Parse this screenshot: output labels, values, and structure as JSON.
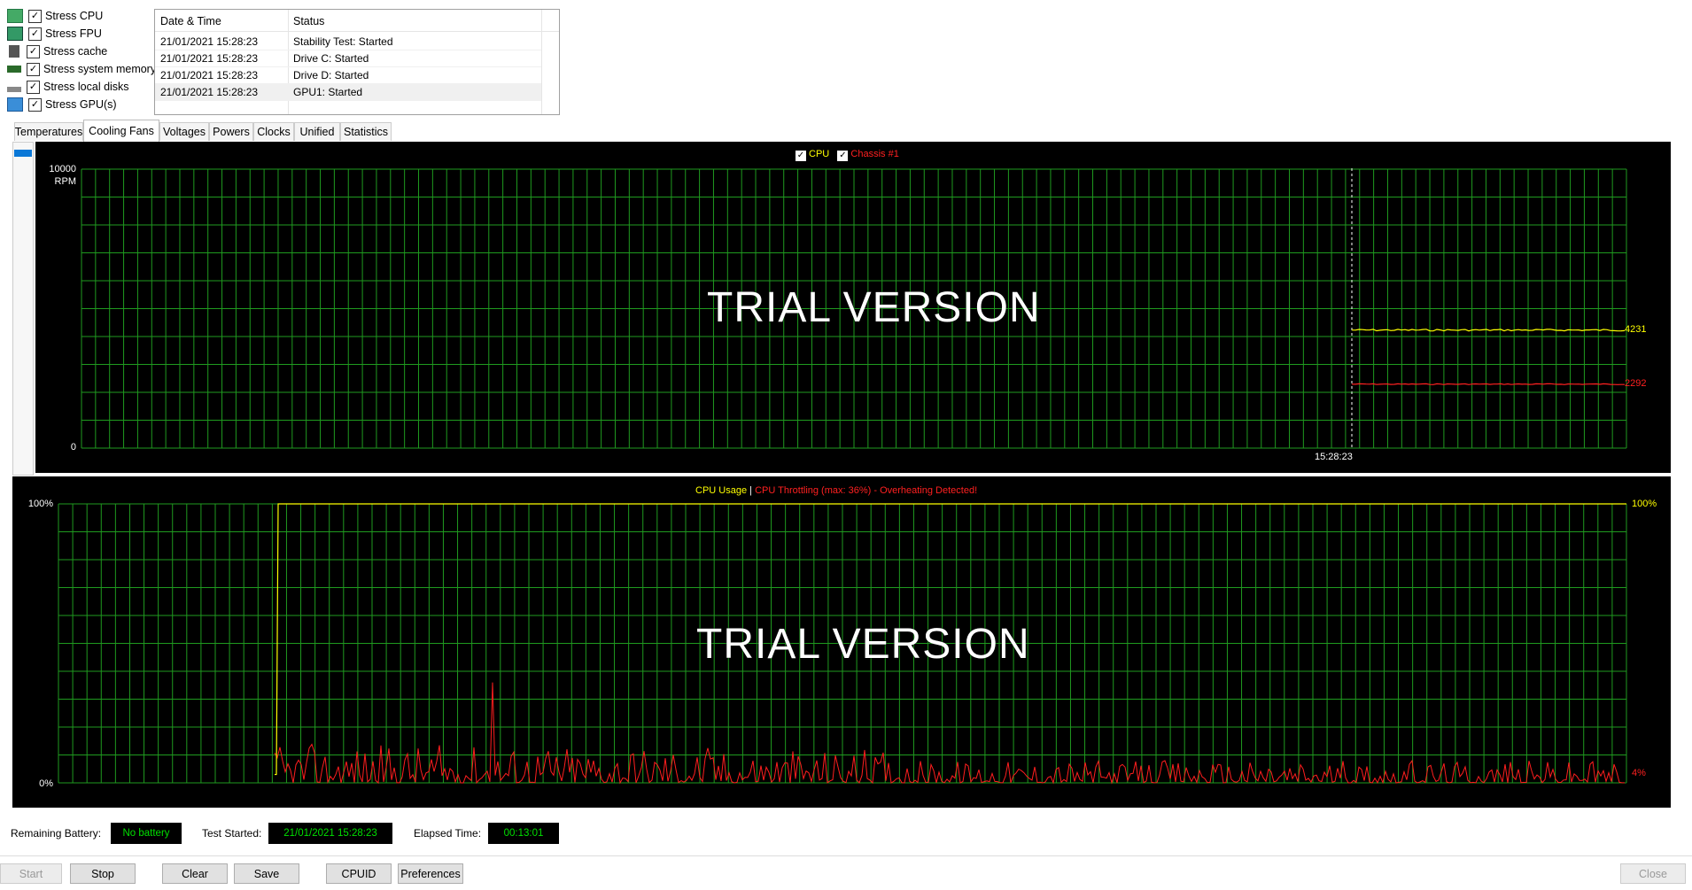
{
  "stress_options": [
    {
      "label": "Stress CPU",
      "checked": true,
      "icon": "cpu-icon"
    },
    {
      "label": "Stress FPU",
      "checked": true,
      "icon": "fpu-icon"
    },
    {
      "label": "Stress cache",
      "checked": true,
      "icon": "cache-icon"
    },
    {
      "label": "Stress system memory",
      "checked": true,
      "icon": "memory-icon"
    },
    {
      "label": "Stress local disks",
      "checked": true,
      "icon": "disk-icon"
    },
    {
      "label": "Stress GPU(s)",
      "checked": true,
      "icon": "gpu-icon"
    }
  ],
  "status_table": {
    "headers": [
      "Date & Time",
      "Status"
    ],
    "rows": [
      {
        "time": "21/01/2021 15:28:23",
        "status": "Stability Test: Started"
      },
      {
        "time": "21/01/2021 15:28:23",
        "status": "Drive C: Started"
      },
      {
        "time": "21/01/2021 15:28:23",
        "status": "Drive D: Started"
      },
      {
        "time": "21/01/2021 15:28:23",
        "status": "GPU1: Started"
      }
    ]
  },
  "tabs": [
    "Temperatures",
    "Cooling Fans",
    "Voltages",
    "Powers",
    "Clocks",
    "Unified",
    "Statistics"
  ],
  "active_tab": "Cooling Fans",
  "fan_chart": {
    "legend": [
      {
        "label": "CPU",
        "color": "#ffff00",
        "checked": true
      },
      {
        "label": "Chassis #1",
        "color": "#ff2020",
        "checked": true
      }
    ],
    "y_top": "10000",
    "y_unit": "RPM",
    "y_bottom": "0",
    "time_label": "15:28:23",
    "watermark": "TRIAL VERSION"
  },
  "cpu_chart": {
    "legend_usage": "CPU Usage",
    "legend_sep": "|",
    "legend_throttle": "CPU Throttling (max: 36%) - Overheating Detected!",
    "y_top": "100%",
    "y_bottom": "0%",
    "watermark": "TRIAL VERSION"
  },
  "chart_data": [
    {
      "type": "line",
      "title": "",
      "ylabel": "RPM",
      "ylim": [
        0,
        10000
      ],
      "series": [
        {
          "name": "CPU",
          "color": "#ffff00",
          "last_value": 4231
        },
        {
          "name": "Chassis #1",
          "color": "#ff2020",
          "last_value": 2292
        }
      ]
    },
    {
      "type": "line",
      "title": "",
      "ylim": [
        0,
        100
      ],
      "series": [
        {
          "name": "CPU Usage",
          "color": "#ffff00",
          "last_value": 100
        },
        {
          "name": "CPU Throttling",
          "color": "#ff2020",
          "last_value": 4
        }
      ]
    }
  ],
  "labels": {
    "fan_cpu_value": "4231",
    "fan_chassis_value": "2292",
    "cpu_usage_value": "100%",
    "throttle_value": "4%"
  },
  "info": {
    "battery_label": "Remaining Battery:",
    "battery_value": "No battery",
    "started_label": "Test Started:",
    "started_value": "21/01/2021 15:28:23",
    "elapsed_label": "Elapsed Time:",
    "elapsed_value": "00:13:01"
  },
  "buttons": {
    "start": "Start",
    "stop": "Stop",
    "clear": "Clear",
    "save": "Save",
    "cpuid": "CPUID",
    "preferences": "Preferences",
    "close": "Close"
  }
}
